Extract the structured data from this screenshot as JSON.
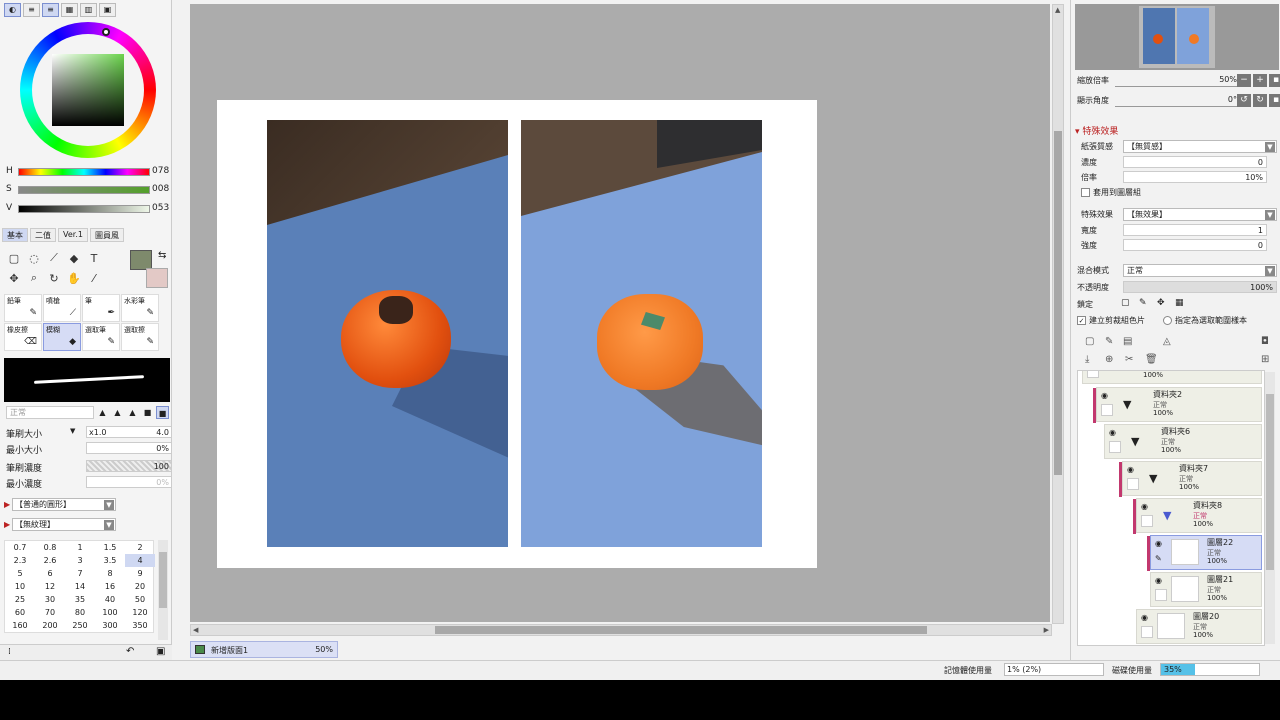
{
  "left": {
    "hsv": [
      {
        "label": "H",
        "value": "078"
      },
      {
        "label": "S",
        "value": "008"
      },
      {
        "label": "V",
        "value": "053"
      }
    ],
    "tabs": [
      "基本",
      "二值",
      "Ver.1",
      "圖員風"
    ],
    "brushes": [
      "鉛筆",
      "噴槍",
      "筆",
      "水彩筆",
      "橡皮擦",
      "模糊",
      "選取筆",
      "選取擦"
    ],
    "params": {
      "brush_size_label": "筆刷大小",
      "brush_size_multiplier": "x1.0",
      "brush_size_value": "4.0",
      "min_size_label": "最小大小",
      "min_size_value": "0%",
      "density_label": "筆刷濃度",
      "density_value": "100",
      "min_density_label": "最小濃度",
      "min_density_value": "0%"
    },
    "paper_texture_dd": "【普通的圓形】",
    "texture_dd": "【無紋理】",
    "sizes": [
      "0.7",
      "0.8",
      "1",
      "1.5",
      "2",
      "2.3",
      "2.6",
      "3",
      "3.5",
      "4",
      "5",
      "6",
      "7",
      "8",
      "9",
      "10",
      "12",
      "14",
      "16",
      "20",
      "25",
      "30",
      "35",
      "40",
      "50",
      "60",
      "70",
      "80",
      "100",
      "120",
      "160",
      "200",
      "250",
      "300",
      "350"
    ]
  },
  "right": {
    "zoom_label": "縮放倍率",
    "zoom_value": "50%",
    "angle_label": "顯示角度",
    "angle_value": "0°",
    "section_title": "特殊效果",
    "texture_label": "紙張質感",
    "texture_value": "【無質感】",
    "strength_label": "濃度",
    "strength_value": "0",
    "scale_label": "倍率",
    "scale_value": "10%",
    "apply_all_label": "套用到圖層組",
    "effect_label": "特殊效果",
    "effect_value": "【無效果】",
    "width_label": "寬度",
    "width_value": "1",
    "strength2_label": "強度",
    "strength2_value": "0",
    "blend_label": "混合模式",
    "blend_value": "正常",
    "opacity_label": "不透明度",
    "opacity_value": "100%",
    "lock_label": "鎖定",
    "clip_label": "建立剪裁組色片",
    "sel_source_label": "指定為選取範圍樣本",
    "layers": [
      {
        "name": "",
        "mode": "",
        "op": "100%"
      },
      {
        "name": "資料夾2",
        "mode": "正常",
        "op": "100%"
      },
      {
        "name": "資料夾6",
        "mode": "正常",
        "op": "100%"
      },
      {
        "name": "資料夾7",
        "mode": "正常",
        "op": "100%"
      },
      {
        "name": "資料夾8",
        "mode": "正常",
        "op": "100%"
      },
      {
        "name": "圖層22",
        "mode": "正常",
        "op": "100%"
      },
      {
        "name": "圖層21",
        "mode": "正常",
        "op": "100%"
      },
      {
        "name": "圖層20",
        "mode": "正常",
        "op": "100%"
      }
    ]
  },
  "doc_tab": {
    "name": "新增版面1",
    "zoom": "50%"
  },
  "status": {
    "memory_label": "記憶體使用量",
    "memory_value": "1% (2%)",
    "disk_label": "磁碟使用量",
    "disk_value": "35%",
    "disk_fraction": 0.35
  },
  "colors": {
    "main_color": "#7e8a6c",
    "sub_color": "#e3c9c6",
    "accent": "#cfd8f2",
    "folder_bar": "#c2386e"
  }
}
